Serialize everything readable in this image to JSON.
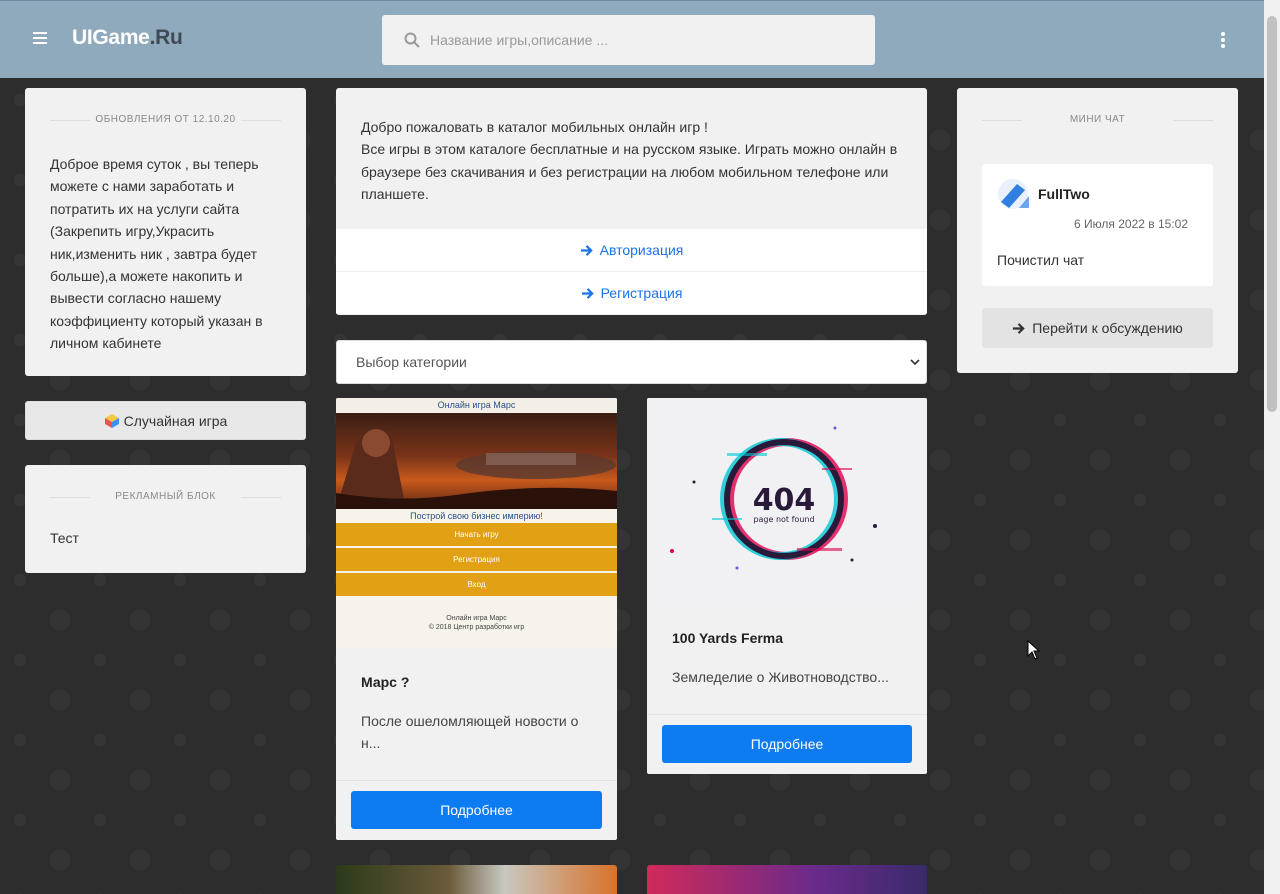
{
  "header": {
    "logo_main": "UIGame",
    "logo_tld": ".Ru",
    "search_placeholder": "Название игры,описание ..."
  },
  "updates": {
    "title": "Обновления от 12.10.20",
    "text": "Доброе время суток , вы теперь можете с нами заработать и потратить их на услуги сайта (Закрепить игру,Украсить ник,изменить ник , завтра будет больше),а можете накопить и вывести согласно нашему коэффициенту который указан в личном кабинете"
  },
  "random_game": {
    "label": "Случайная игра"
  },
  "ads": {
    "title": "Рекламный блок",
    "text": "Тест"
  },
  "welcome": {
    "line1": "Добро пожаловать в каталог мобильных онлайн игр !",
    "line2": "Все игры в этом каталоге бесплатные и на русском языке. Играть можно онлайн в браузере без скачивания и без регистрации на любом мобильном телефоне или планшете.",
    "login_label": "Авторизация",
    "register_label": "Регистрация"
  },
  "category_select": {
    "selected": "Выбор категории"
  },
  "games": [
    {
      "title": "Марс ?",
      "desc": "После ошеломляющей новости о н...",
      "button": "Подробнее",
      "thumb": {
        "top": "Онлайн игра Марс",
        "tagline": "Построй свою бизнес империю!",
        "buttons": [
          "Начать игру",
          "Регистрация",
          "Вход"
        ],
        "footer1": "Онлайн игра Марс",
        "footer2": "© 2018 Центр разработки игр"
      }
    },
    {
      "title": "100 Yards Ferma",
      "desc": "Земледелие о Животноводство...",
      "button": "Подробнее",
      "thumb": {
        "code": "404",
        "caption": "page not found"
      }
    }
  ],
  "chat": {
    "title": "Мини чат",
    "user": "FullTwo",
    "date": "6 Июля 2022 в 15:02",
    "message": "Почистил чат",
    "button": "Перейти к обсуждению"
  },
  "colors": {
    "header_bg": "#8faabd",
    "accent": "#0d7cf2",
    "link": "#1a73e8",
    "panel": "#f1f1f2"
  }
}
